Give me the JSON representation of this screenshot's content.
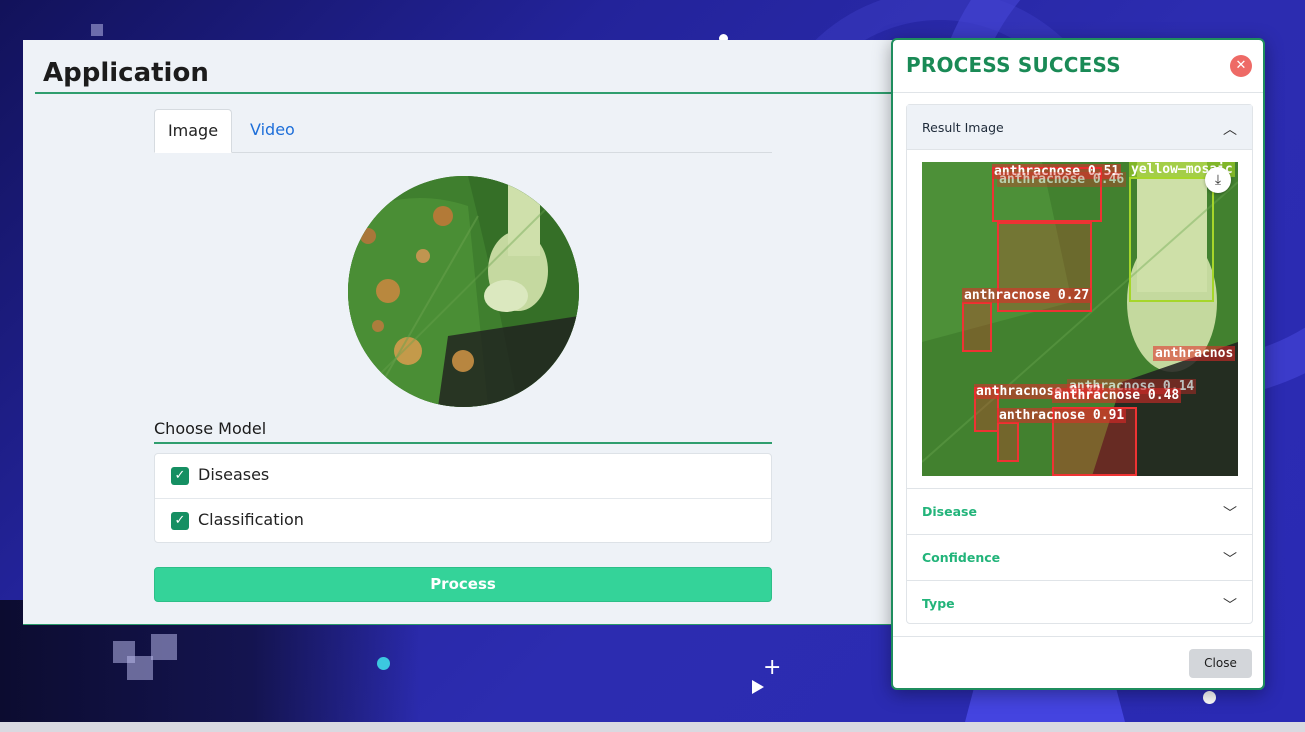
{
  "app": {
    "title": "Application",
    "tabs": [
      {
        "label": "Image",
        "active": true
      },
      {
        "label": "Video",
        "active": false
      }
    ],
    "choose_model_label": "Choose Model",
    "models": [
      {
        "label": "Diseases",
        "checked": true
      },
      {
        "label": "Classification",
        "checked": true
      }
    ],
    "process_label": "Process",
    "accent_color": "#34d399"
  },
  "modal": {
    "title": "PROCESS SUCCESS",
    "close_icon": "close-icon",
    "sections": [
      {
        "label": "Result Image",
        "expanded": true
      },
      {
        "label": "Disease",
        "expanded": false
      },
      {
        "label": "Confidence",
        "expanded": false
      },
      {
        "label": "Type",
        "expanded": false
      }
    ],
    "detections": [
      {
        "label": "anthracnose 0.51"
      },
      {
        "label": "anthracnose 0.46"
      },
      {
        "label": "yellow—mosaic"
      },
      {
        "label": "anthracnose 0.27"
      },
      {
        "label": "anthracnos"
      },
      {
        "label": "anthracnose 0.72"
      },
      {
        "label": "anthracnose 0.14"
      },
      {
        "label": "anthracnose 0.48"
      },
      {
        "label": "anthracnose 0.91"
      }
    ],
    "close_label": "Close",
    "title_color": "#1a8a56"
  }
}
